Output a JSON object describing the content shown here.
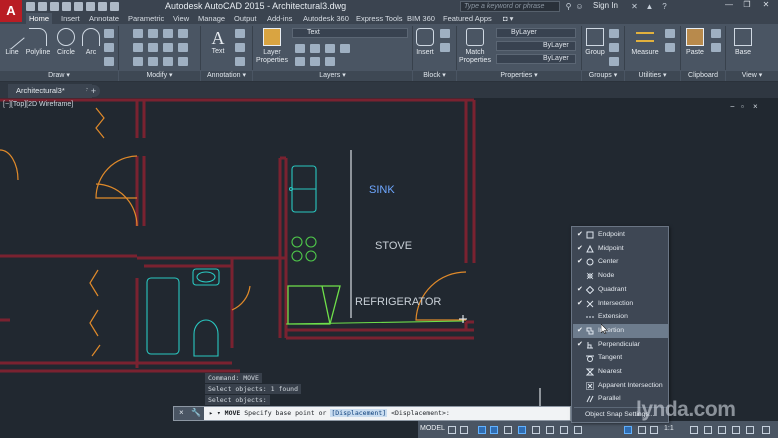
{
  "app": {
    "logo_letter": "A",
    "title": "Autodesk AutoCAD 2015 - Architectural3.dwg",
    "search_placeholder": "Type a keyword or phrase",
    "sign_in": "Sign In"
  },
  "ribbon_tabs": [
    "Home",
    "Insert",
    "Annotate",
    "Parametric",
    "View",
    "Manage",
    "Output",
    "Add-ins",
    "Autodesk 360",
    "Express Tools",
    "BIM 360",
    "Featured Apps"
  ],
  "ribbon": {
    "draw_tools": [
      "Line",
      "Polyline",
      "Circle",
      "Arc"
    ],
    "text_tool": "Text",
    "layer_props": "Layer Properties",
    "layer_combo": "Text",
    "insert": "Insert",
    "match_props": "Match Properties",
    "bylayer": "ByLayer",
    "group": "Group",
    "measure": "Measure",
    "paste": "Paste",
    "base": "Base",
    "panels": [
      "Draw",
      "Modify",
      "Annotation",
      "Layers",
      "Block",
      "Properties",
      "Groups",
      "Utilities",
      "Clipboard",
      "View"
    ]
  },
  "file_tab": {
    "name": "Architectural3*",
    "close": "×",
    "new_tab": "+"
  },
  "viewport": {
    "label": "[−][Top][2D Wireframe]",
    "controls": [
      "−",
      "▫",
      "×"
    ]
  },
  "plan_labels": {
    "sink": "SINK",
    "stove": "STOVE",
    "fridge": "REFRIGERATOR"
  },
  "command": {
    "history": [
      "Command:  MOVE",
      "Select objects: 1 found",
      "Select objects:"
    ],
    "prompt_cmd": "MOVE",
    "prompt_text": "Specify base point or",
    "prompt_option": "[Displacement]",
    "prompt_default": "<Displacement>:",
    "buttons": [
      "×",
      "🔧"
    ]
  },
  "statusbar": {
    "model": "MODEL",
    "scale": "1:1"
  },
  "osnap_menu": {
    "items": [
      {
        "label": "Endpoint",
        "checked": true,
        "icon": "square-icon"
      },
      {
        "label": "Midpoint",
        "checked": true,
        "icon": "triangle-icon"
      },
      {
        "label": "Center",
        "checked": true,
        "icon": "circle-icon"
      },
      {
        "label": "Node",
        "checked": false,
        "icon": "node-icon"
      },
      {
        "label": "Quadrant",
        "checked": true,
        "icon": "diamond-icon"
      },
      {
        "label": "Intersection",
        "checked": true,
        "icon": "x-icon"
      },
      {
        "label": "Extension",
        "checked": false,
        "icon": "dash-icon"
      },
      {
        "label": "Insertion",
        "checked": true,
        "icon": "insertion-icon"
      },
      {
        "label": "Perpendicular",
        "checked": true,
        "icon": "perpendicular-icon"
      },
      {
        "label": "Tangent",
        "checked": false,
        "icon": "tangent-icon"
      },
      {
        "label": "Nearest",
        "checked": false,
        "icon": "hourglass-icon"
      },
      {
        "label": "Apparent Intersection",
        "checked": false,
        "icon": "apparent-icon"
      },
      {
        "label": "Parallel",
        "checked": false,
        "icon": "parallel-icon"
      }
    ],
    "hovered_index": 7,
    "settings_label": "Object Snap Settings..."
  },
  "watermark": "lynda.com",
  "colors": {
    "wall": "#7a2230",
    "door": "#e08a2a",
    "fixture": "#29c7c0",
    "stove": "#4fc94a",
    "highlight": "#3f9bff"
  }
}
